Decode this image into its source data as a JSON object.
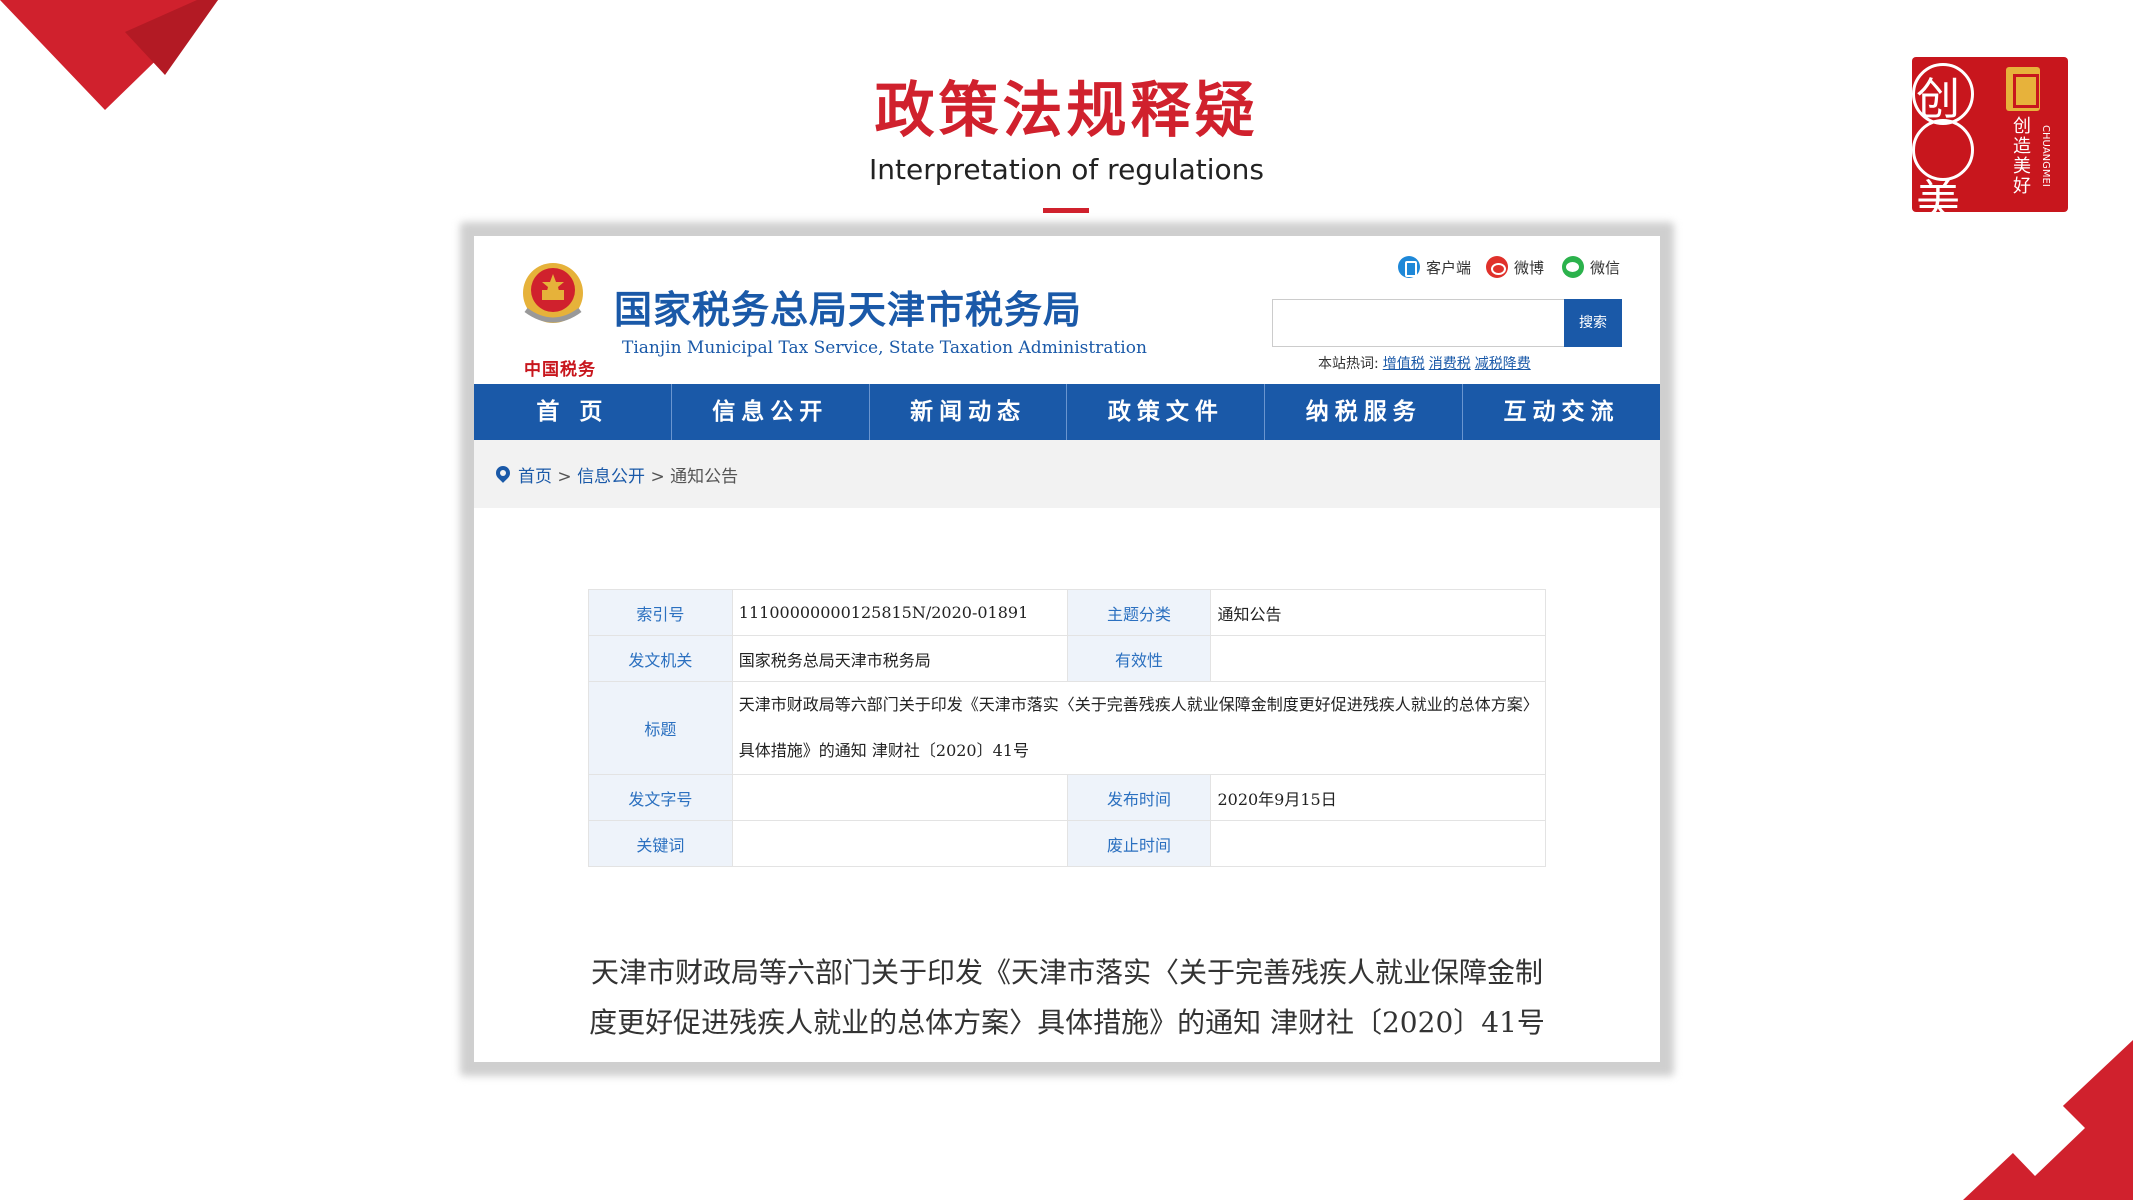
{
  "slide": {
    "title": "政策法规释疑",
    "subtitle": "Interpretation of regulations",
    "logo": {
      "char_top": "创",
      "char_bottom": "美",
      "vertical_text": "创造美好",
      "vertical_en": "CHUANGMEI"
    },
    "accent_color": "#d0212d"
  },
  "site": {
    "emblem_text": "中国税务",
    "name": "国家税务总局天津市税务局",
    "name_en": "Tianjin Municipal Tax Service, State Taxation Administration",
    "social": [
      {
        "icon": "client-icon",
        "label": "客户端"
      },
      {
        "icon": "weibo-icon",
        "label": "微博"
      },
      {
        "icon": "wechat-icon",
        "label": "微信"
      }
    ],
    "search": {
      "value": "",
      "button": "搜索"
    },
    "hot_words": {
      "label": "本站热词:",
      "items": [
        "增值税",
        "消费税",
        "减税降费"
      ]
    },
    "nav": [
      "首 页",
      "信息公开",
      "新闻动态",
      "政策文件",
      "纳税服务",
      "互动交流"
    ],
    "brand_color": "#1a59a8"
  },
  "breadcrumb": {
    "home": "首页",
    "sep": ">",
    "section": "信息公开",
    "current": "通知公告"
  },
  "meta": {
    "index_label": "索引号",
    "index_value": "11100000000125815N/2020-01891",
    "topic_label": "主题分类",
    "topic_value": "通知公告",
    "issuer_label": "发文机关",
    "issuer_value": "国家税务总局天津市税务局",
    "validity_label": "有效性",
    "validity_value": "",
    "title_label": "标题",
    "title_value": "天津市财政局等六部门关于印发《天津市落实〈关于完善残疾人就业保障金制度更好促进残疾人就业的总体方案〉具体措施》的通知 津财社〔2020〕41号",
    "docno_label": "发文字号",
    "docno_value": "",
    "pubdate_label": "发布时间",
    "pubdate_value": "2020年9月15日",
    "keywords_label": "关键词",
    "keywords_value": "",
    "expire_label": "废止时间",
    "expire_value": ""
  },
  "document": {
    "title_line1": "天津市财政局等六部门关于印发《天津市落实〈关于完善残疾人就业保障金制",
    "title_line2": "度更好促进残疾人就业的总体方案〉具体措施》的通知 津财社〔2020〕41号"
  }
}
